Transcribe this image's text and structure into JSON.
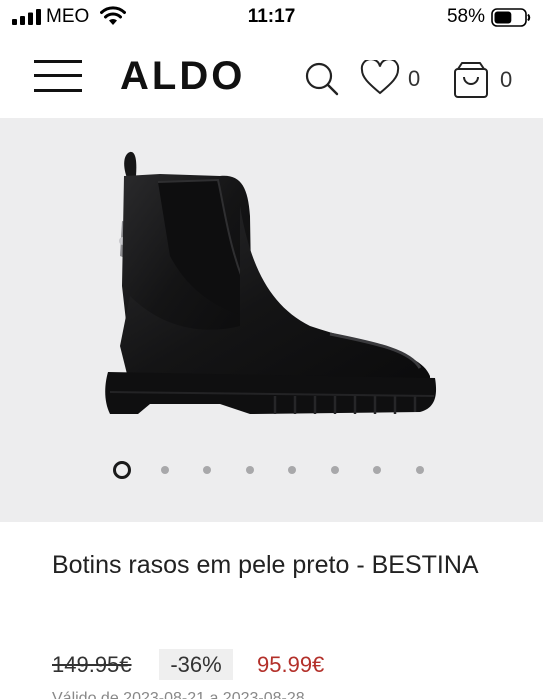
{
  "status_bar": {
    "carrier": "MEO",
    "time": "11:17",
    "battery_percent": "58%",
    "battery_level": 0.58,
    "signal_bars": 4
  },
  "header": {
    "brand": "ALDO",
    "wishlist_count": "0",
    "cart_count": "0",
    "icons": [
      "hamburger-menu-icon",
      "search-icon",
      "heart-icon",
      "shopping-bag-icon"
    ]
  },
  "gallery": {
    "image_subject": "black leather chelsea boot",
    "image_count": 8,
    "active_index": 0,
    "background_color": "#ededee"
  },
  "product": {
    "title": "Botins rasos em pele preto - BESTINA",
    "original_price": "149.95€",
    "discount": "-36%",
    "sale_price": "95.99€",
    "sale_price_color": "#b3302a",
    "validity_text": "Válido de 2023-08-21 a 2023-08-28"
  }
}
